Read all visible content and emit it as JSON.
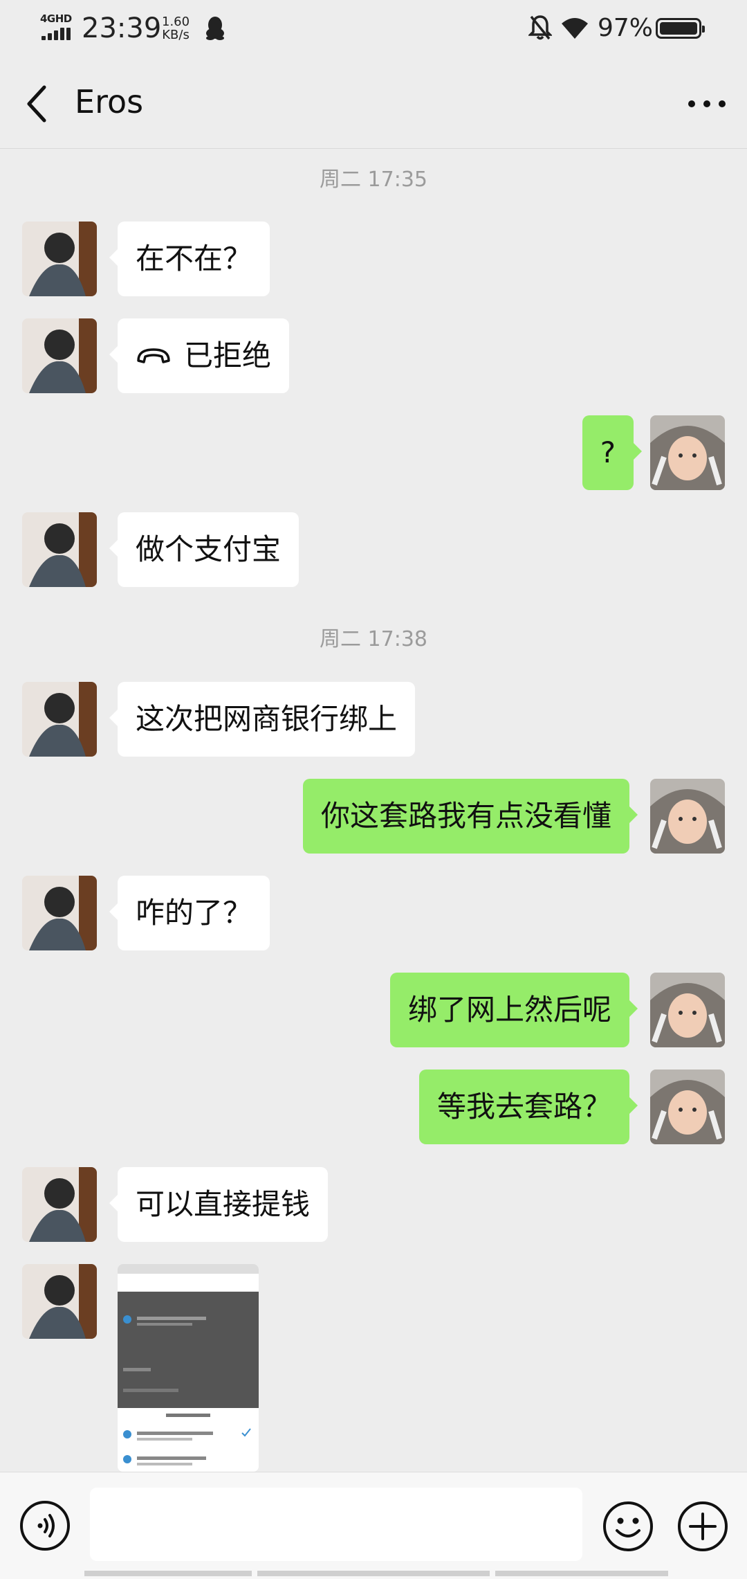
{
  "status_bar": {
    "network": "4GHD",
    "time": "23:39",
    "speed_value": "1.60",
    "speed_unit": "KB/s",
    "battery": "97%"
  },
  "header": {
    "title": "Eros"
  },
  "messages": [
    {
      "type": "time",
      "text": "周二 17:35"
    },
    {
      "type": "text",
      "side": "in",
      "text": "在不在？"
    },
    {
      "type": "call",
      "side": "in",
      "text": "已拒绝"
    },
    {
      "type": "text",
      "side": "out",
      "text": "?"
    },
    {
      "type": "text",
      "side": "in",
      "text": "做个支付宝"
    },
    {
      "type": "time",
      "text": "周二 17:38"
    },
    {
      "type": "text",
      "side": "in",
      "text": "这次把网商银行绑上"
    },
    {
      "type": "text",
      "side": "out",
      "text": "你这套路我有点没看懂"
    },
    {
      "type": "text",
      "side": "in",
      "text": "咋的了？"
    },
    {
      "type": "text",
      "side": "out",
      "text": "绑了网上然后呢"
    },
    {
      "type": "text",
      "side": "out",
      "text": "等我去套路？"
    },
    {
      "type": "text",
      "side": "in",
      "text": "可以直接提钱"
    },
    {
      "type": "image",
      "side": "in"
    }
  ],
  "input": {
    "placeholder": ""
  },
  "colors": {
    "background": "#EDEDED",
    "outgoing_bubble": "#95EC69",
    "incoming_bubble": "#FFFFFF"
  }
}
